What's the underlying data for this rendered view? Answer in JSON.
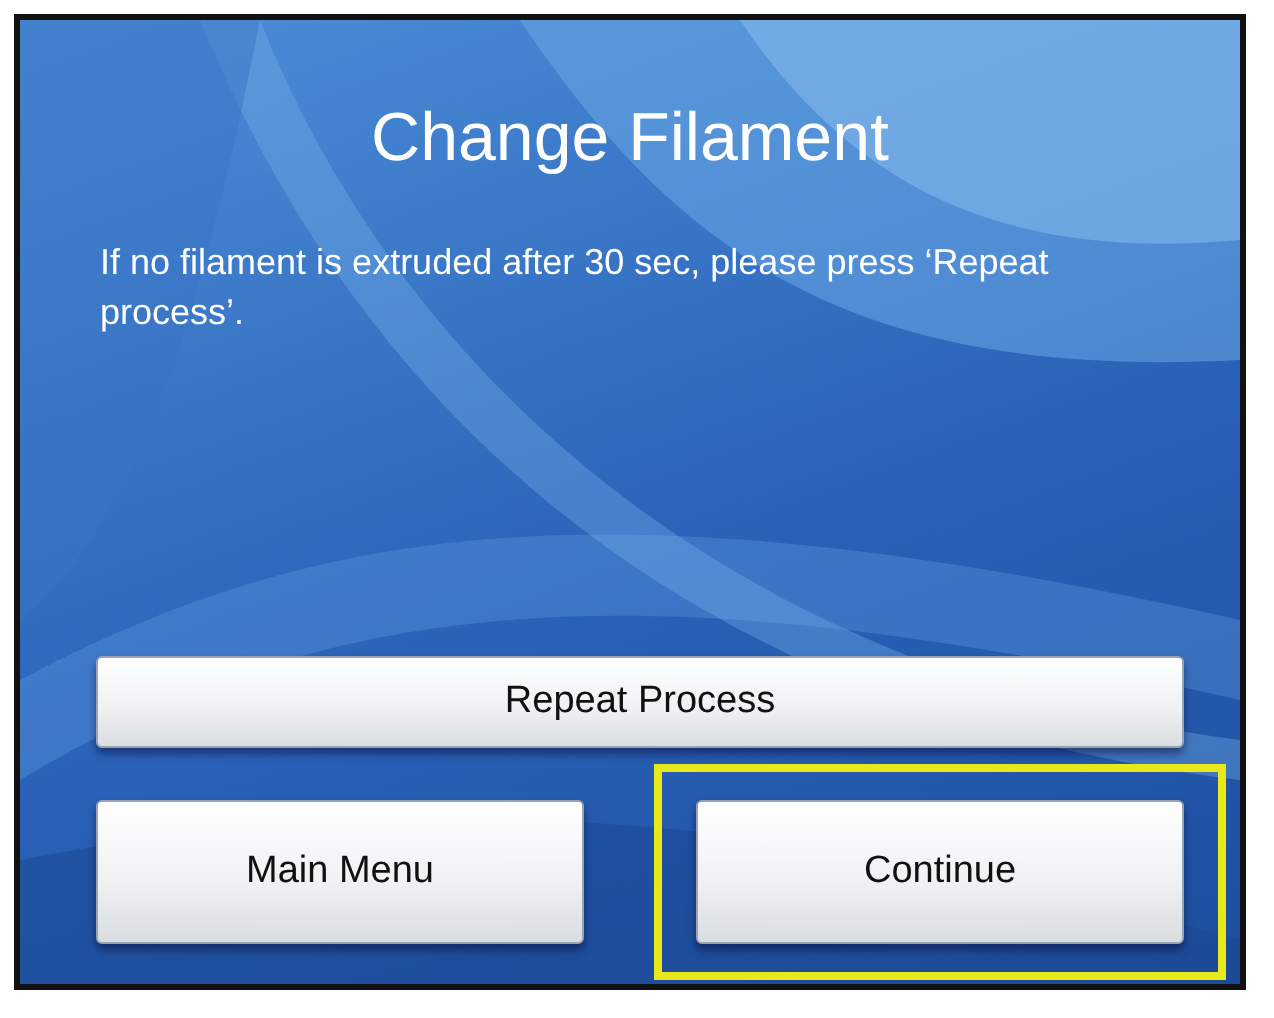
{
  "screen": {
    "title": "Change Filament",
    "message": "If no filament is extruded after 30 sec, please press ‘Repeat process’.",
    "buttons": [
      {
        "label": "Repeat Process",
        "kind": "wide",
        "highlighted": false
      },
      {
        "label": "Main Menu",
        "kind": "half",
        "highlighted": false
      },
      {
        "label": "Continue",
        "kind": "half",
        "highlighted": true
      }
    ]
  }
}
